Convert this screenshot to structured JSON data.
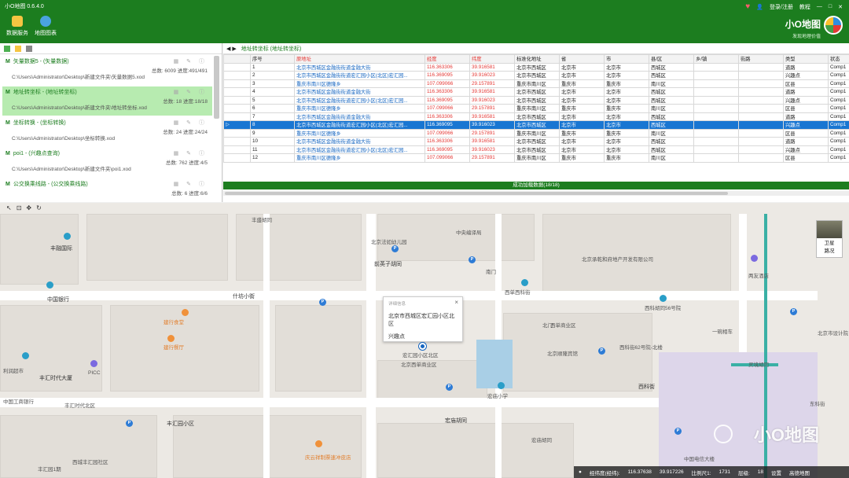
{
  "app": {
    "title": "小O地图 0.6.4.0",
    "topright": {
      "login": "登录/注册",
      "tutorial": "教程",
      "min": "—",
      "max": "□",
      "close": "✕"
    },
    "ribbon": [
      {
        "label": "数据服务",
        "color": "#f5c542"
      },
      {
        "label": "地图图表",
        "color": "#4aa3df"
      }
    ],
    "brand": {
      "name": "小O地图",
      "slogan": "发现地理价值"
    }
  },
  "left_panel": {
    "tasks": [
      {
        "name": "矢量数据5 - (矢量数据)",
        "stat": "总数: 6009 进度:491/491",
        "path": "C:\\Users\\Administrator\\Desktop\\新建文件夹\\矢量数据5.xod",
        "active": false
      },
      {
        "name": "地址转坐标 - (地址转坐标)",
        "stat": "总数: 18 进度:18/18",
        "path": "C:\\Users\\Administrator\\Desktop\\新建文件夹\\地址转坐标.xod",
        "active": true
      },
      {
        "name": "坐标转换 - (坐标转换)",
        "stat": "总数: 24 进度:24/24",
        "path": "C:\\Users\\Administrator\\Desktop\\坐标转换.xod",
        "active": false
      },
      {
        "name": "poi1 - (兴趣点查询)",
        "stat": "总数: 762 进度:4/5",
        "path": "C:\\Users\\Administrator\\Desktop\\新建文件夹\\poi1.xod",
        "active": false
      },
      {
        "name": "公交换乘线路 - (公交换乘线路)",
        "stat": "总数: 6 进度:6/6",
        "path": "",
        "active": false
      }
    ]
  },
  "grid": {
    "tab_label": "地址转坐标 (地址转坐标)",
    "columns": [
      "",
      "序号",
      "原地址",
      "经度",
      "纬度",
      "标准化地址",
      "省",
      "市",
      "县/区",
      "乡/镇",
      "街路",
      "类型",
      "状态"
    ],
    "rows": [
      [
        "1",
        "北京市西城区金融街街道金融大街",
        "116.363306",
        "39.916581",
        "北京市西城区",
        "北京市",
        "北京市",
        "西城区",
        "",
        "",
        "道路",
        "Comp1"
      ],
      [
        "2",
        "北京市西城区金融街街道宏汇园小区(北区)宏汇园...",
        "116.369095",
        "39.916023",
        "北京市西城区",
        "北京市",
        "北京市",
        "西城区",
        "",
        "",
        "兴趣点",
        "Comp1"
      ],
      [
        "3",
        "重庆市南川区德隆乡",
        "107.099066",
        "29.157891",
        "重庆市南川区",
        "重庆市",
        "重庆市",
        "南川区",
        "",
        "",
        "区县",
        "Comp1"
      ],
      [
        "4",
        "北京市西城区金融街街道金融大街",
        "116.363306",
        "39.916581",
        "北京市西城区",
        "北京市",
        "北京市",
        "西城区",
        "",
        "",
        "道路",
        "Comp1"
      ],
      [
        "5",
        "北京市西城区金融街街道宏汇园小区(北区)宏汇园...",
        "116.369095",
        "39.916023",
        "北京市西城区",
        "北京市",
        "北京市",
        "西城区",
        "",
        "",
        "兴趣点",
        "Comp1"
      ],
      [
        "6",
        "重庆市南川区德隆乡",
        "107.099066",
        "29.157891",
        "重庆市南川区",
        "重庆市",
        "重庆市",
        "南川区",
        "",
        "",
        "区县",
        "Comp1"
      ],
      [
        "7",
        "北京市西城区金融街街道金融大街",
        "116.363306",
        "39.916581",
        "北京市西城区",
        "北京市",
        "北京市",
        "西城区",
        "",
        "",
        "道路",
        "Comp1"
      ],
      [
        "8",
        "北京市西城区金融街街道宏汇园小区(北区)宏汇园...",
        "116.369095",
        "39.916023",
        "北京市西城区",
        "北京市",
        "北京市",
        "西城区",
        "",
        "",
        "兴趣点",
        "Comp1"
      ],
      [
        "9",
        "重庆市南川区德隆乡",
        "107.099066",
        "29.157891",
        "重庆市南川区",
        "重庆市",
        "重庆市",
        "南川区",
        "",
        "",
        "区县",
        "Comp1"
      ],
      [
        "10",
        "北京市西城区金融街街道金融大街",
        "116.363306",
        "39.916581",
        "北京市西城区",
        "北京市",
        "北京市",
        "西城区",
        "",
        "",
        "道路",
        "Comp1"
      ],
      [
        "11",
        "北京市西城区金融街街道宏汇园小区(北区)宏汇园...",
        "116.369095",
        "39.916023",
        "北京市西城区",
        "北京市",
        "北京市",
        "西城区",
        "",
        "",
        "兴趣点",
        "Comp1"
      ],
      [
        "12",
        "重庆市南川区德隆乡",
        "107.099066",
        "29.157891",
        "重庆市南川区",
        "重庆市",
        "重庆市",
        "南川区",
        "",
        "",
        "区县",
        "Comp1"
      ]
    ],
    "selected_row": 8,
    "status": "成功加载数据(18/18)"
  },
  "map": {
    "popup": {
      "title": "详细信息",
      "address": "北京市西城区宏汇园小区北区",
      "type": "兴趣点"
    },
    "labels": [
      "丰融国际",
      "中国银行",
      "什坊小街",
      "建行食堂",
      "建行餐厅",
      "利润超市",
      "丰汇时代大厦",
      "PICC",
      "中国工商银行",
      "丰汇时代北区",
      "丰汇园小区",
      "西城丰汇园社区",
      "丰汇园1期",
      "丰盛胡同",
      "北京法如幼儿园",
      "前英子胡同",
      "中央编译局",
      "宏汇园小区北区",
      "南门",
      "西单西科街",
      "北京西单商业区",
      "宏庙小学",
      "宏庙胡同",
      "北京顺隆宾馆",
      "西单商业区",
      "西科街62号院-北楼",
      "西科街",
      "西科胡同56号院",
      "两友酒店",
      "灵境胡同",
      "中国电信大楼",
      "一碗相车",
      "东科街",
      "北京市设计院",
      "北京承乾和府地产开发有限公司",
      "宏庙胡同",
      "庆云祥制票速冲皮店",
      "北门"
    ],
    "layers": {
      "satellite": "卫星",
      "roads": "路况"
    },
    "status": {
      "lng_label": "经纬度(经纬):",
      "lng": "116.37638",
      "lat": "39.917226",
      "scale_label": "比例尺1:",
      "scale": "1731",
      "level_label": "层级:",
      "level": "18",
      "settings": "设置",
      "map_label": "高德地图"
    },
    "watermark": "小O地图"
  }
}
